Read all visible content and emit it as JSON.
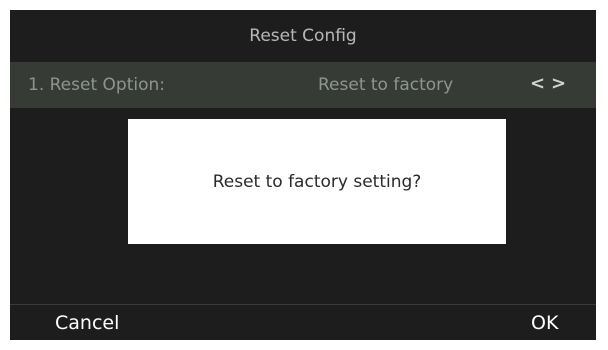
{
  "header": {
    "title": "Reset Config"
  },
  "option_row": {
    "label": "1. Reset Option:",
    "value": "Reset to factory",
    "left_arrow_icon": "chevron-left-icon",
    "right_arrow_icon": "chevron-right-icon"
  },
  "dialog": {
    "message": "Reset to factory setting?"
  },
  "softkeys": {
    "cancel": "Cancel",
    "ok": "OK"
  },
  "colors": {
    "screen_bg": "#1d1d1d",
    "row_bg": "#363b36",
    "dialog_bg": "#ffffff"
  }
}
